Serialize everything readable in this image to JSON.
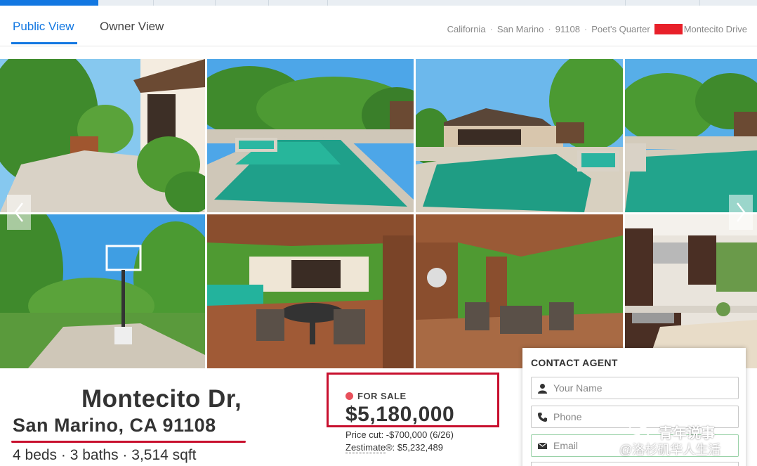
{
  "tabs": {
    "public": "Public View",
    "owner": "Owner View"
  },
  "breadcrumb": {
    "state": "California",
    "city": "San Marino",
    "zip": "91108",
    "neighborhood": "Poet's Quarter",
    "street": "Montecito Drive",
    "separator": "·"
  },
  "gallery": {
    "photos": [
      "driveway",
      "pool",
      "house-pool",
      "pool-side",
      "basketball-hoop",
      "patio",
      "pergola-patio",
      "kitchen"
    ]
  },
  "listing": {
    "address_line1": "Montecito Dr,",
    "address_line2": "San Marino, CA 91108",
    "stats": "4 beds · 3 baths · 3,514 sqft",
    "status": "FOR SALE",
    "price": "$5,180,000",
    "price_cut": "Price cut: -$700,000 (6/26)",
    "zestimate_label": "Zestimate",
    "zestimate_value": "®: $5,232,489"
  },
  "contact": {
    "title": "CONTACT AGENT",
    "name_placeholder": "Your Name",
    "phone_placeholder": "Phone",
    "email_placeholder": "Email"
  },
  "watermark": {
    "line1": "青年说事",
    "line2": "@洛杉矶华人生活"
  },
  "colors": {
    "accent": "#1277e1",
    "highlight_red": "#c8102e",
    "status_dot": "#e8505b"
  }
}
